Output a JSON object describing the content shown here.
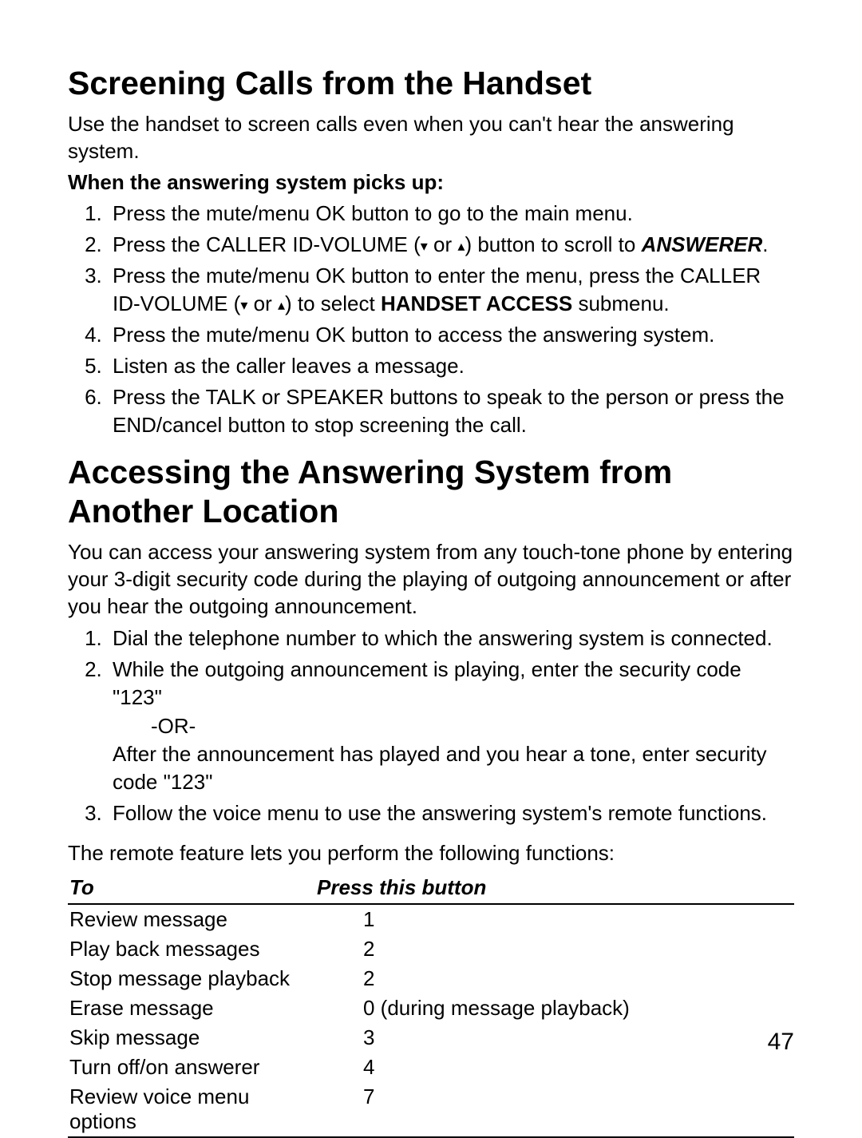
{
  "section1": {
    "heading": "Screening Calls from the Handset",
    "intro": "Use the handset to screen calls even when you can't hear the answering system.",
    "subhead": "When the answering system picks up:",
    "steps": [
      "Press the mute/menu OK button to go to the main menu.",
      "Press the CALLER ID-VOLUME (",
      " or ",
      ") button to scroll to ",
      "ANSWERER",
      ".",
      "Press the mute/menu OK button to enter the menu, press the CALLER ID-VOLUME (",
      " or ",
      ") to select ",
      "HANDSET ACCESS",
      " submenu.",
      "Press the mute/menu OK button to access the answering system.",
      "Listen as the caller leaves a message.",
      "Press the TALK or SPEAKER buttons to speak to the person or press the END/cancel button to stop screening the call."
    ],
    "icons": {
      "down": "▾",
      "up": "▴"
    }
  },
  "section2": {
    "heading": "Accessing the Answering System from Another Location",
    "intro": "You can access your answering system from any touch-tone phone by entering your 3-digit security code during the playing of outgoing announcement or after you hear the outgoing announcement.",
    "steps": {
      "s1": "Dial the telephone number to which the answering system is connected.",
      "s2a": "While the outgoing announcement is playing, enter the security code \"123\"",
      "s2b": "-OR-",
      "s2c": "After the announcement has played and you hear a tone, enter security code \"123\"",
      "s3": "Follow the voice menu to use the answering system's remote functions."
    },
    "followup": "The remote feature lets you perform the following functions:"
  },
  "table": {
    "headers": {
      "to": "To",
      "press": "Press this button"
    },
    "rows": [
      {
        "to": "Review message",
        "press": "1"
      },
      {
        "to": "Play back messages",
        "press": "2"
      },
      {
        "to": "Stop message playback",
        "press": "2"
      },
      {
        "to": "Erase message",
        "press": "0 (during message playback)"
      },
      {
        "to": "Skip message",
        "press": "3"
      },
      {
        "to": "Turn off/on answerer",
        "press": "4"
      },
      {
        "to": "Review voice menu options",
        "press": "7"
      }
    ]
  },
  "page_number": "47"
}
